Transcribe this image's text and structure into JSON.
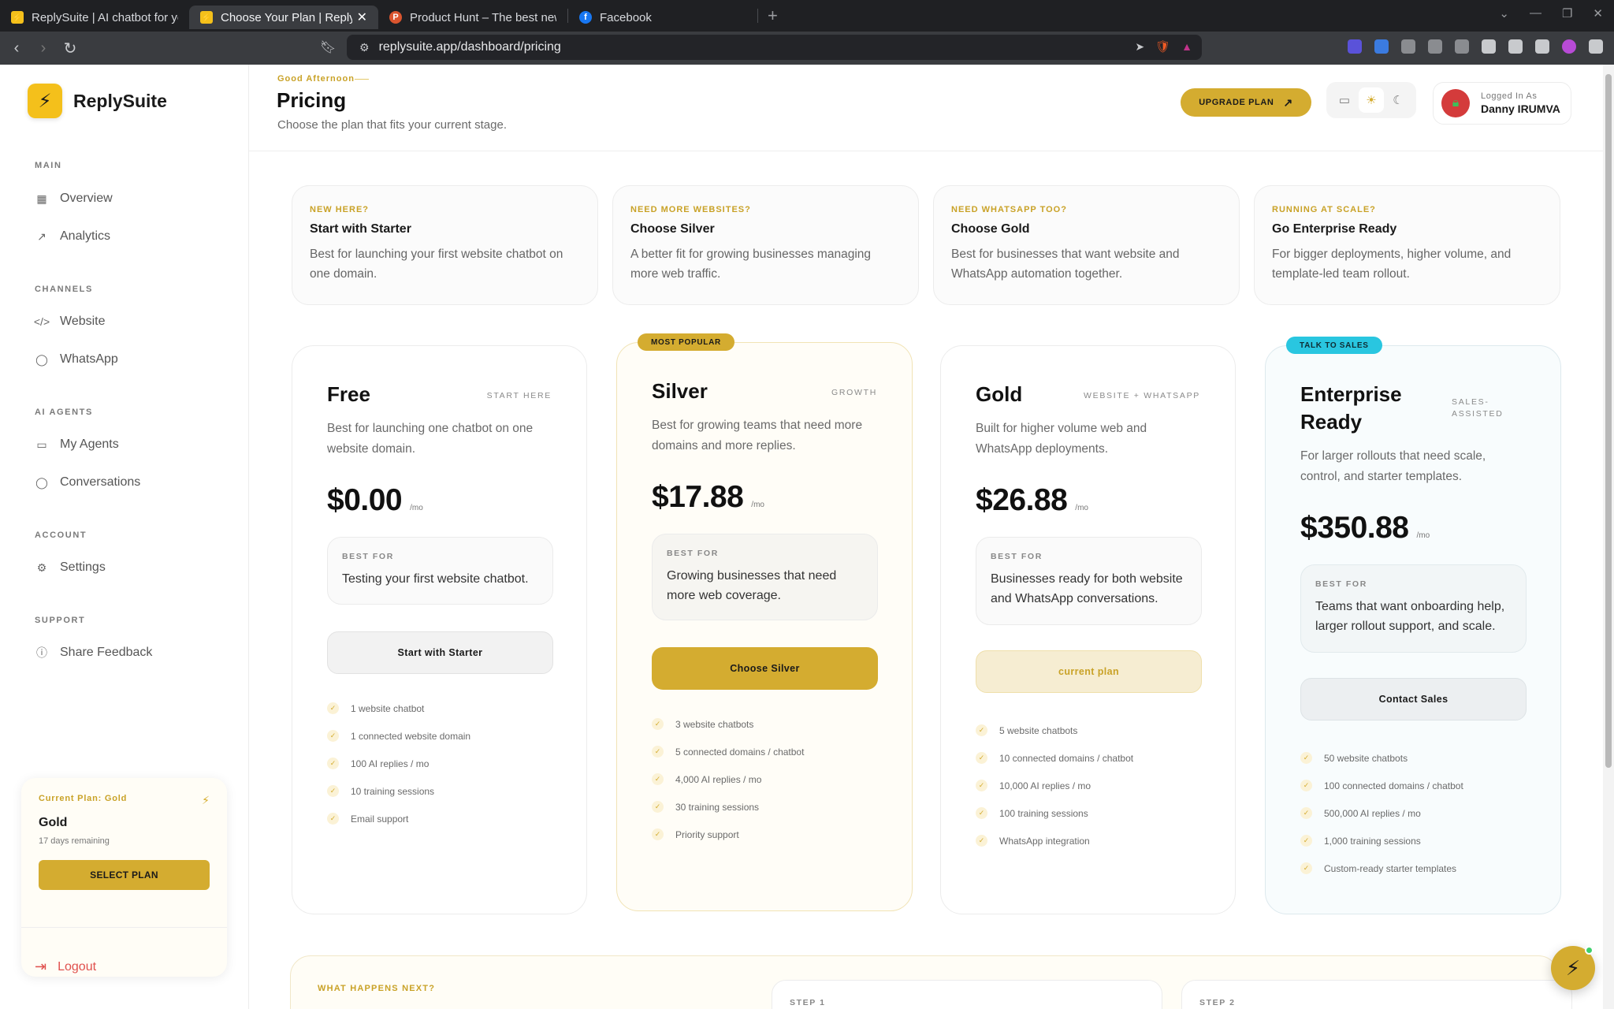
{
  "browser": {
    "tabs": [
      {
        "title": "ReplySuite | AI chatbot for your",
        "active": false,
        "favicon_color": "#f4c01b"
      },
      {
        "title": "Choose Your Plan | ReplySuite",
        "active": true,
        "favicon_color": "#f4c01b"
      },
      {
        "title": "Product Hunt – The best new prod",
        "active": false,
        "favicon_color": "#da552f"
      },
      {
        "title": "Facebook",
        "active": false,
        "favicon_color": "#1877f2"
      }
    ],
    "url": "replysuite.app/dashboard/pricing"
  },
  "sidebar": {
    "brand": "ReplySuite",
    "sections": [
      {
        "title": "MAIN",
        "items": [
          {
            "label": "Overview",
            "icon": "grid-icon"
          },
          {
            "label": "Analytics",
            "icon": "trend-icon"
          }
        ]
      },
      {
        "title": "CHANNELS",
        "items": [
          {
            "label": "Website",
            "icon": "code-icon"
          },
          {
            "label": "WhatsApp",
            "icon": "chat-icon"
          }
        ]
      },
      {
        "title": "AI AGENTS",
        "items": [
          {
            "label": "My Agents",
            "icon": "message-square-icon"
          },
          {
            "label": "Conversations",
            "icon": "chat-icon"
          }
        ]
      },
      {
        "title": "ACCOUNT",
        "items": [
          {
            "label": "Settings",
            "icon": "gear-icon"
          }
        ]
      },
      {
        "title": "SUPPORT",
        "items": [
          {
            "label": "Share Feedback",
            "icon": "help-icon"
          }
        ]
      }
    ],
    "plan_card": {
      "label": "Current Plan: Gold",
      "plan": "Gold",
      "remaining": "17 days remaining",
      "button": "SELECT PLAN"
    },
    "logout": "Logout"
  },
  "header": {
    "greeting": "Good Afternoon",
    "title": "Pricing",
    "subtitle": "Choose the plan that fits your current stage.",
    "upgrade_button": "UPGRADE PLAN",
    "user_label": "Logged In As",
    "user_name": "Danny IRUMVA"
  },
  "hints": [
    {
      "eyebrow": "NEW HERE?",
      "title": "Start with Starter",
      "desc": "Best for launching your first website chatbot on one domain."
    },
    {
      "eyebrow": "NEED MORE WEBSITES?",
      "title": "Choose Silver",
      "desc": "A better fit for growing businesses managing more web traffic."
    },
    {
      "eyebrow": "NEED WHATSAPP TOO?",
      "title": "Choose Gold",
      "desc": "Best for businesses that want website and WhatsApp automation together."
    },
    {
      "eyebrow": "RUNNING AT SCALE?",
      "title": "Go Enterprise Ready",
      "desc": "For bigger deployments, higher volume, and template-led team rollout."
    }
  ],
  "plans": [
    {
      "name": "Free",
      "tag": "START HERE",
      "badge": "",
      "desc": "Best for launching one chatbot on one website domain.",
      "price": "$0.00",
      "per": "/mo",
      "best_for_label": "BEST FOR",
      "best_for": "Testing your first website chatbot.",
      "button": "Start with Starter",
      "features": [
        "1 website chatbot",
        "1 connected website domain",
        "100 AI replies / mo",
        "10 training sessions",
        "Email support"
      ]
    },
    {
      "name": "Silver",
      "tag": "GROWTH",
      "badge": "MOST POPULAR",
      "desc": "Best for growing teams that need more domains and more replies.",
      "price": "$17.88",
      "per": "/mo",
      "best_for_label": "BEST FOR",
      "best_for": "Growing businesses that need more web coverage.",
      "button": "Choose Silver",
      "features": [
        "3 website chatbots",
        "5 connected domains / chatbot",
        "4,000 AI replies / mo",
        "30 training sessions",
        "Priority support"
      ]
    },
    {
      "name": "Gold",
      "tag": "WEBSITE + WHATSAPP",
      "badge": "",
      "desc": "Built for higher volume web and WhatsApp deployments.",
      "price": "$26.88",
      "per": "/mo",
      "best_for_label": "BEST FOR",
      "best_for": "Businesses ready for both website and WhatsApp conversations.",
      "button": "current plan",
      "features": [
        "5 website chatbots",
        "10 connected domains / chatbot",
        "10,000 AI replies / mo",
        "100 training sessions",
        "WhatsApp integration"
      ]
    },
    {
      "name": "Enterprise Ready",
      "tag": "SALES-ASSISTED",
      "badge": "TALK TO SALES",
      "desc": "For larger rollouts that need scale, control, and starter templates.",
      "price": "$350.88",
      "per": "/mo",
      "best_for_label": "BEST FOR",
      "best_for": "Teams that want onboarding help, larger rollout support, and scale.",
      "button": "Contact Sales",
      "features": [
        "50 website chatbots",
        "100 connected domains / chatbot",
        "500,000 AI replies / mo",
        "1,000 training sessions",
        "Custom-ready starter templates"
      ]
    }
  ],
  "next": {
    "eyebrow": "WHAT HAPPENS NEXT?",
    "step1": "STEP 1",
    "step2": "STEP 2"
  },
  "colors": {
    "accent": "#d4ac30",
    "brand": "#f4c01b",
    "teal": "#29c6e0",
    "danger": "#e0504d"
  }
}
